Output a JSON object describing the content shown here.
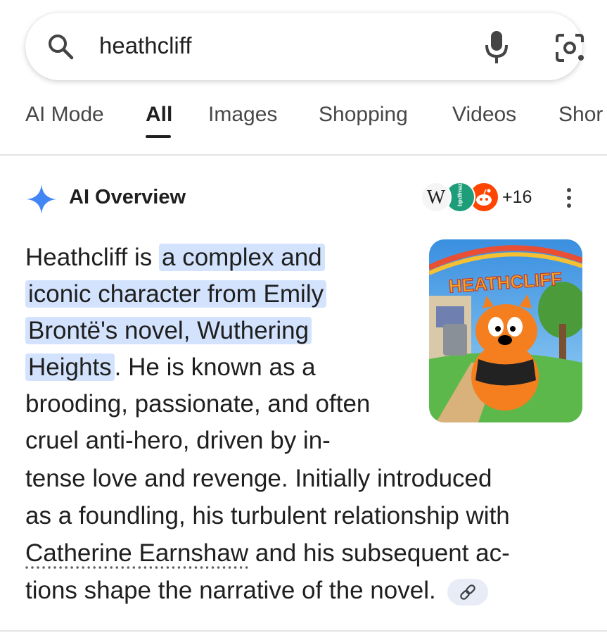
{
  "search": {
    "query": "heathcliff"
  },
  "tabs": [
    {
      "label": "AI Mode"
    },
    {
      "label": "All"
    },
    {
      "label": "Images"
    },
    {
      "label": "Shopping"
    },
    {
      "label": "Videos"
    },
    {
      "label": "Shor"
    }
  ],
  "active_tab": "All",
  "overview": {
    "title": "AI Overview",
    "sources": {
      "wiki_letter": "W",
      "second_label": "bpdfmaz",
      "more_count": "+16"
    },
    "thumbnail_text": "HEATHCLIFF",
    "lines": [
      {
        "plain": "Heathcliff is ",
        "hl": "a complex and"
      },
      {
        "hl": "iconic character from Emily"
      },
      {
        "hl": "Brontë's novel, Wuthering"
      },
      {
        "hl": "Heights",
        "plain": ". He is known as a"
      },
      {
        "plain": "brooding, passionate, and often"
      },
      {
        "plain": "cruel anti-hero, driven by in-"
      },
      {
        "plain": "tense love and revenge. Initially introduced"
      },
      {
        "plain": "as a foundling, his turbulent relationship with"
      },
      {
        "link": "Catherine Earnshaw",
        "plain": " and his subsequent ac-"
      },
      {
        "plain": "tions shape the narrative of the novel."
      }
    ]
  },
  "colors": {
    "highlight": "#d3e3fd",
    "sparkle": "#4285f4",
    "text": "#1f1f1f"
  }
}
